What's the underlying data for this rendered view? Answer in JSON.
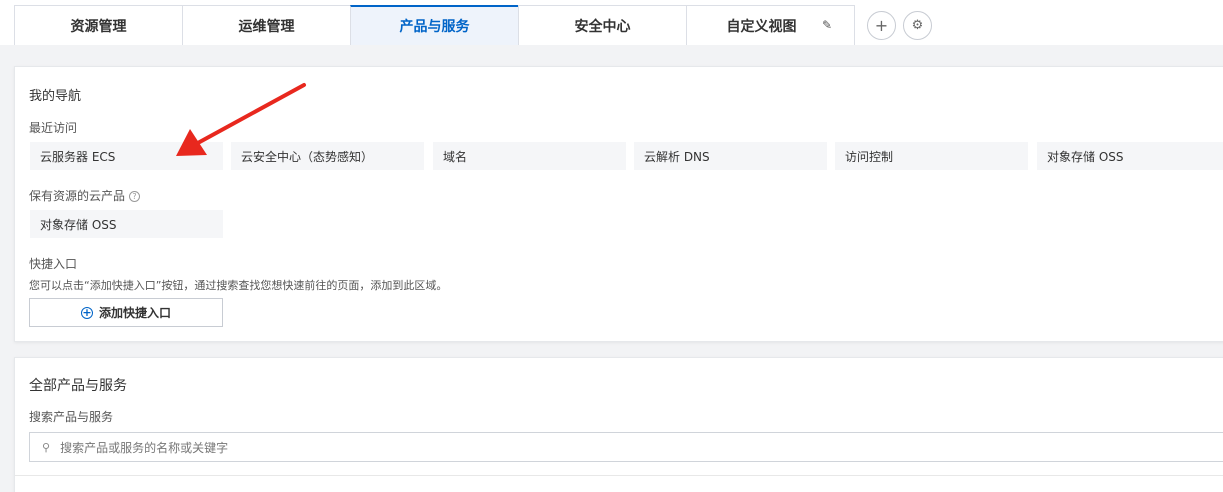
{
  "tabs": [
    {
      "label": "资源管理",
      "active": false
    },
    {
      "label": "运维管理",
      "active": false
    },
    {
      "label": "产品与服务",
      "active": true
    },
    {
      "label": "安全中心",
      "active": false
    },
    {
      "label": "自定义视图",
      "active": false
    }
  ],
  "tab_edit_icon": "✎",
  "add_tab_icon": "+",
  "settings_icon": "⚙",
  "accent_color": "#0064c8",
  "nav": {
    "title": "我的导航",
    "recent_label": "最近访问",
    "recent_items": [
      "云服务器 ECS",
      "云安全中心（态势感知）",
      "域名",
      "云解析 DNS",
      "访问控制",
      "对象存储 OSS"
    ],
    "owned_label": "保有资源的云产品",
    "owned_help": "?",
    "owned_items": [
      "对象存储 OSS"
    ],
    "shortcut_label": "快捷入口",
    "shortcut_hint": "您可以点击“添加快捷入口”按钮，通过搜索查找您想快速前往的页面，添加到此区域。",
    "add_shortcut_label": "添加快捷入口"
  },
  "all_products": {
    "title": "全部产品与服务",
    "search_label": "搜索产品与服务",
    "search_placeholder": "搜索产品或服务的名称或关键字"
  },
  "annotation_color": "#e8281e"
}
